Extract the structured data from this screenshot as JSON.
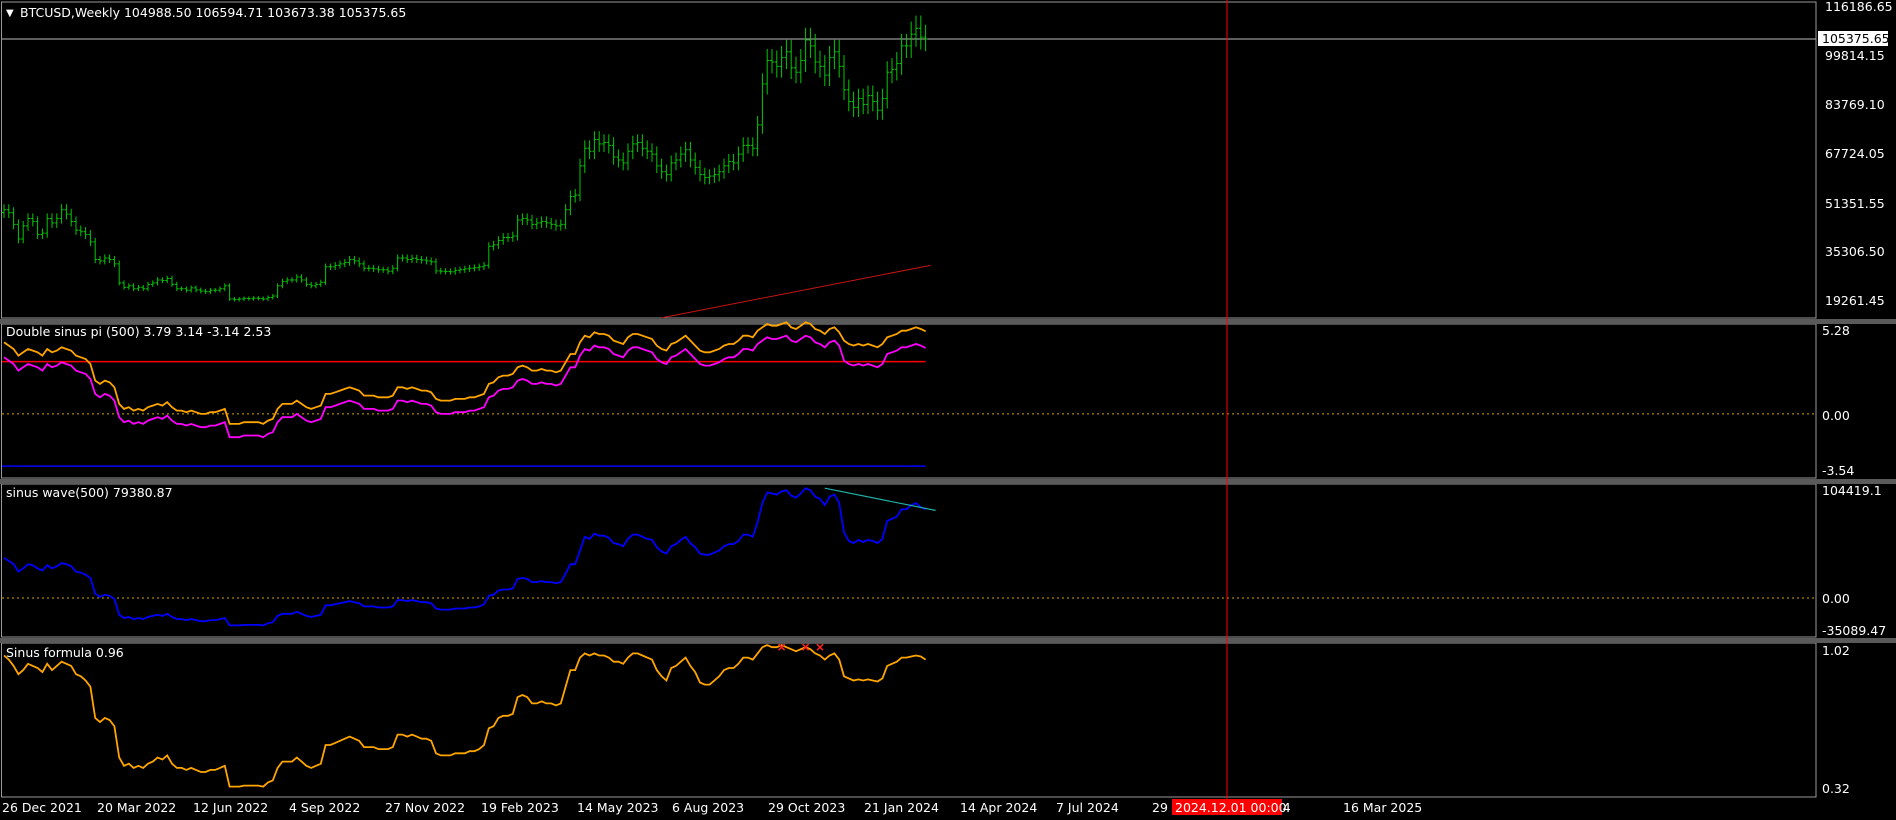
{
  "symbol_header": "BTCUSD,Weekly  104988.50 106594.71 103673.38 105375.65",
  "panes": {
    "price": {
      "price_ticks": [
        "116186.65",
        "99814.15",
        "83769.10",
        "67724.05",
        "51351.55",
        "35306.50",
        "19261.45"
      ],
      "current_price_label": "105375.65",
      "current_price": 105375.65,
      "range": [
        10000,
        118000
      ],
      "bar_color": "#00c800",
      "ma_color": "#c81414"
    },
    "double": {
      "title": "Double sinus pi (500) 3.79 3.14 -3.14 2.53",
      "ticks": [
        "5.28",
        "0.00",
        "-3.54"
      ],
      "range": [
        -3.85,
        5.4
      ],
      "level_red": 3.14,
      "level_blue": -3.14,
      "level_zero": 0,
      "colors": {
        "orange": "#ffa500",
        "magenta": "#ff00ff",
        "red": "#ff0000",
        "blue": "#0000ff",
        "dotted": "#d2aa00"
      }
    },
    "sinus": {
      "title": "sinus wave(500) 79380.87",
      "ticks": [
        "104419.1",
        "0.00",
        "-35089.47"
      ],
      "range": [
        -37000,
        108000
      ],
      "colors": {
        "line": "#0000ff",
        "trend": "#20b2aa",
        "dotted": "#d2aa00"
      }
    },
    "formula": {
      "title": "Sinus formula 0.96",
      "ticks": [
        "1.02",
        "0.32"
      ],
      "range": [
        0.3,
        1.04
      ],
      "colors": {
        "line": "#ffa500",
        "marker": "#ff2020"
      }
    }
  },
  "x_axis": {
    "labels": [
      "26 Dec 2021",
      "20 Mar 2022",
      "12 Jun 2022",
      "4 Sep 2022",
      "27 Nov 2022",
      "19 Feb 2023",
      "14 May 2023",
      "6 Aug 2023",
      "29 Oct 2023",
      "21 Jan 2024",
      "14 Apr 2024",
      "7 Jul 2024",
      "29",
      "c 2024",
      "16 Mar 2025"
    ],
    "cursor_label": "2024.12.01 00:00"
  },
  "chart_data": [
    {
      "type": "candlestick",
      "title": "BTCUSD,Weekly",
      "x_start": "2021-12-26",
      "x_interval": "weekly",
      "ylim": [
        19261.45,
        116186.65
      ],
      "current_price": 105375.65,
      "last_bar_ohlc": [
        104988.5,
        106594.71,
        103673.38,
        105375.65
      ],
      "close": [
        47000,
        46000,
        42000,
        37000,
        41500,
        44000,
        43000,
        38500,
        39000,
        44000,
        42500,
        44000,
        47000,
        45500,
        43000,
        40000,
        39500,
        38500,
        36000,
        30000,
        29500,
        30500,
        30000,
        28500,
        22000,
        20500,
        21000,
        20000,
        20500,
        20000,
        21500,
        22000,
        23000,
        22800,
        23500,
        21500,
        20000,
        20000,
        19500,
        20300,
        19600,
        19200,
        19000,
        19500,
        19500,
        20000,
        21000,
        16500,
        16300,
        16500,
        16700,
        16600,
        16800,
        16700,
        16500,
        17000,
        17500,
        21000,
        22500,
        23000,
        23000,
        24000,
        23000,
        21500,
        21000,
        21500,
        22200,
        27500,
        27500,
        28000,
        28500,
        29000,
        30000,
        29500,
        28500,
        27000,
        27000,
        26800,
        26500,
        26500,
        26000,
        27000,
        30500,
        30500,
        30000,
        30400,
        30000,
        29800,
        29500,
        29200,
        26100,
        26000,
        25900,
        25800,
        26300,
        26500,
        26800,
        27000,
        27200,
        27500,
        28000,
        34500,
        35000,
        36500,
        37500,
        37500,
        38000,
        43500,
        44000,
        43500,
        42000,
        42500,
        43000,
        42500,
        42000,
        41500,
        42000,
        47000,
        51500,
        52000,
        62000,
        68000,
        67000,
        71000,
        69500,
        70000,
        69000,
        65000,
        64000,
        63000,
        67000,
        69500,
        70000,
        68000,
        67000,
        66000,
        62000,
        60000,
        59000,
        63000,
        64000,
        66000,
        67500,
        64000,
        61500,
        59000,
        58000,
        58500,
        59000,
        60000,
        62000,
        63500,
        63000,
        66000,
        69000,
        69000,
        68000,
        76000,
        90000,
        98000,
        97500,
        96000,
        99000,
        101000,
        95500,
        94000,
        98000,
        105000,
        103000,
        97500,
        96000,
        93000,
        99000,
        101000,
        96000,
        88000,
        84000,
        82000,
        85000,
        83000,
        86000,
        84000,
        81000,
        85000,
        94000,
        95000,
        97000,
        103000,
        103000,
        107000,
        109000,
        106000,
        105375
      ]
    },
    {
      "type": "line",
      "title": "Double sinus pi (500) 3.79 3.14 -3.14 2.53",
      "x_start": "2021-12-26",
      "x_interval": "weekly",
      "ylim": [
        -3.54,
        5.28
      ],
      "series": [
        {
          "name": "3.79",
          "values": [
            4.3,
            4.1,
            3.9,
            3.5,
            3.7,
            3.9,
            3.8,
            3.7,
            3.5,
            3.9,
            3.7,
            3.8,
            4.0,
            3.9,
            3.8,
            3.5,
            3.4,
            3.3,
            3.0,
            2.0,
            1.8,
            2.0,
            1.9,
            1.6,
            0.6,
            0.3,
            0.4,
            0.2,
            0.3,
            0.2,
            0.4,
            0.5,
            0.6,
            0.5,
            0.7,
            0.4,
            0.2,
            0.2,
            0.1,
            0.2,
            0.1,
            0.0,
            0.0,
            0.1,
            0.1,
            0.2,
            0.3,
            -0.6,
            -0.6,
            -0.6,
            -0.5,
            -0.5,
            -0.5,
            -0.5,
            -0.6,
            -0.4,
            -0.3,
            0.3,
            0.6,
            0.6,
            0.6,
            0.8,
            0.6,
            0.4,
            0.3,
            0.4,
            0.5,
            1.2,
            1.2,
            1.3,
            1.4,
            1.5,
            1.6,
            1.5,
            1.4,
            1.1,
            1.1,
            1.1,
            1.0,
            1.0,
            1.0,
            1.1,
            1.6,
            1.6,
            1.5,
            1.6,
            1.5,
            1.4,
            1.4,
            1.3,
            0.9,
            0.8,
            0.8,
            0.8,
            0.9,
            0.9,
            0.9,
            1.0,
            1.0,
            1.1,
            1.2,
            1.8,
            1.9,
            2.2,
            2.3,
            2.3,
            2.4,
            2.8,
            2.9,
            2.8,
            2.6,
            2.6,
            2.7,
            2.6,
            2.6,
            2.5,
            2.6,
            3.1,
            3.6,
            3.6,
            4.3,
            4.7,
            4.6,
            4.9,
            4.8,
            4.8,
            4.7,
            4.4,
            4.3,
            4.2,
            4.6,
            4.8,
            4.8,
            4.7,
            4.6,
            4.5,
            4.1,
            3.9,
            3.8,
            4.2,
            4.3,
            4.5,
            4.7,
            4.4,
            4.1,
            3.8,
            3.7,
            3.7,
            3.8,
            3.9,
            4.1,
            4.2,
            4.2,
            4.4,
            4.7,
            4.7,
            4.6,
            5.0,
            5.2,
            5.4,
            5.3,
            5.3,
            5.4,
            5.5,
            5.2,
            5.1,
            5.3,
            5.5,
            5.4,
            5.1,
            5.0,
            4.8,
            5.1,
            5.2,
            4.9,
            4.4,
            4.2,
            4.1,
            4.2,
            4.1,
            4.2,
            4.1,
            4.0,
            4.2,
            4.6,
            4.7,
            4.8,
            5.0,
            5.0,
            5.1,
            5.2,
            5.1,
            4.96
          ]
        },
        {
          "name": "2.53",
          "values": [
            3.4,
            3.2,
            3.0,
            2.6,
            2.8,
            3.0,
            2.9,
            2.8,
            2.6,
            3.0,
            2.8,
            2.9,
            3.1,
            3.0,
            2.9,
            2.6,
            2.5,
            2.4,
            2.1,
            1.2,
            1.0,
            1.2,
            1.1,
            0.8,
            -0.2,
            -0.5,
            -0.4,
            -0.6,
            -0.5,
            -0.6,
            -0.4,
            -0.3,
            -0.2,
            -0.3,
            -0.1,
            -0.4,
            -0.6,
            -0.6,
            -0.7,
            -0.6,
            -0.7,
            -0.8,
            -0.8,
            -0.7,
            -0.7,
            -0.6,
            -0.5,
            -1.4,
            -1.4,
            -1.4,
            -1.3,
            -1.3,
            -1.3,
            -1.3,
            -1.4,
            -1.2,
            -1.1,
            -0.5,
            -0.2,
            -0.2,
            -0.2,
            0.0,
            -0.2,
            -0.4,
            -0.5,
            -0.4,
            -0.3,
            0.4,
            0.4,
            0.5,
            0.6,
            0.7,
            0.8,
            0.7,
            0.6,
            0.3,
            0.3,
            0.3,
            0.2,
            0.2,
            0.2,
            0.3,
            0.8,
            0.8,
            0.7,
            0.8,
            0.7,
            0.6,
            0.6,
            0.5,
            0.1,
            0.0,
            0.0,
            0.0,
            0.1,
            0.1,
            0.1,
            0.2,
            0.2,
            0.3,
            0.4,
            1.0,
            1.1,
            1.4,
            1.5,
            1.5,
            1.6,
            2.0,
            2.1,
            2.0,
            1.8,
            1.8,
            1.9,
            1.8,
            1.8,
            1.7,
            1.8,
            2.3,
            2.8,
            2.8,
            3.5,
            3.9,
            3.8,
            4.1,
            4.0,
            4.0,
            3.9,
            3.6,
            3.5,
            3.4,
            3.8,
            4.0,
            4.0,
            3.9,
            3.8,
            3.7,
            3.3,
            3.1,
            3.0,
            3.4,
            3.5,
            3.7,
            3.9,
            3.6,
            3.3,
            3.0,
            2.9,
            2.9,
            3.0,
            3.1,
            3.3,
            3.4,
            3.4,
            3.6,
            3.9,
            3.9,
            3.8,
            4.2,
            4.4,
            4.6,
            4.5,
            4.5,
            4.6,
            4.7,
            4.4,
            4.3,
            4.5,
            4.7,
            4.6,
            4.3,
            4.2,
            4.0,
            4.3,
            4.4,
            4.1,
            3.2,
            3.0,
            2.9,
            3.0,
            2.9,
            3.0,
            2.9,
            2.8,
            3.0,
            3.6,
            3.7,
            3.8,
            4.0,
            4.0,
            4.1,
            4.2,
            4.1,
            3.96
          ]
        }
      ]
    },
    {
      "type": "line",
      "title": "sinus wave(500) 79380.87",
      "x_start": "2021-12-26",
      "x_interval": "weekly",
      "ylim": [
        -35089.47,
        104419.1
      ],
      "series": [
        {
          "name": "79380.87",
          "values": [
            38000,
            35000,
            32000,
            25000,
            28000,
            32000,
            31000,
            28000,
            26000,
            31000,
            28000,
            30000,
            33000,
            32000,
            30000,
            25000,
            24000,
            22000,
            19000,
            4000,
            1000,
            3000,
            2000,
            -1000,
            -16000,
            -19000,
            -18000,
            -20000,
            -19000,
            -20000,
            -18000,
            -17000,
            -16000,
            -17000,
            -15000,
            -18000,
            -20000,
            -20000,
            -21000,
            -20000,
            -21000,
            -22000,
            -22000,
            -21000,
            -21000,
            -20000,
            -19000,
            -26000,
            -26000,
            -26000,
            -25500,
            -25500,
            -25500,
            -25500,
            -26000,
            -24000,
            -23000,
            -17000,
            -15000,
            -15000,
            -15000,
            -13000,
            -15000,
            -17000,
            -18000,
            -17000,
            -16000,
            -7000,
            -7000,
            -6000,
            -5000,
            -4000,
            -3000,
            -4000,
            -5000,
            -8000,
            -8000,
            -8000,
            -9000,
            -9000,
            -9000,
            -8000,
            -2000,
            -2000,
            -3000,
            -2000,
            -3000,
            -4000,
            -4000,
            -5000,
            -10000,
            -11000,
            -11000,
            -11000,
            -10000,
            -10000,
            -10000,
            -9000,
            -9000,
            -8000,
            -6000,
            2000,
            3000,
            7000,
            8000,
            8000,
            9000,
            18000,
            19000,
            18000,
            15000,
            15000,
            16000,
            15000,
            15000,
            14000,
            15000,
            23000,
            32000,
            32000,
            45000,
            58000,
            56000,
            61000,
            59000,
            59000,
            57000,
            52000,
            51000,
            49000,
            56000,
            60000,
            60000,
            58000,
            56000,
            55000,
            48000,
            44000,
            42000,
            49000,
            51000,
            55000,
            58000,
            52000,
            48000,
            42000,
            41000,
            41000,
            43000,
            45000,
            49000,
            51000,
            51000,
            54000,
            60000,
            60000,
            58000,
            72000,
            90000,
            100000,
            99000,
            98000,
            101000,
            102000,
            97000,
            95000,
            99000,
            104000,
            102000,
            96000,
            94000,
            88000,
            96000,
            98000,
            90000,
            62000,
            54000,
            52000,
            55000,
            53000,
            55000,
            54000,
            52000,
            56000,
            73000,
            75000,
            77000,
            84000,
            84000,
            88000,
            90000,
            86000,
            84000
          ]
        }
      ]
    },
    {
      "type": "line",
      "title": "Sinus formula 0.96",
      "x_start": "2021-12-26",
      "x_interval": "weekly",
      "ylim": [
        0.32,
        1.02
      ],
      "series": [
        {
          "name": "0.96",
          "values": [
            0.98,
            0.96,
            0.93,
            0.89,
            0.91,
            0.94,
            0.93,
            0.92,
            0.9,
            0.94,
            0.91,
            0.93,
            0.95,
            0.94,
            0.93,
            0.89,
            0.88,
            0.86,
            0.83,
            0.68,
            0.66,
            0.68,
            0.67,
            0.64,
            0.49,
            0.45,
            0.46,
            0.44,
            0.45,
            0.44,
            0.46,
            0.47,
            0.49,
            0.48,
            0.5,
            0.46,
            0.44,
            0.44,
            0.43,
            0.44,
            0.43,
            0.42,
            0.42,
            0.43,
            0.43,
            0.44,
            0.45,
            0.35,
            0.35,
            0.35,
            0.355,
            0.355,
            0.355,
            0.355,
            0.35,
            0.37,
            0.38,
            0.44,
            0.47,
            0.47,
            0.47,
            0.49,
            0.47,
            0.45,
            0.44,
            0.45,
            0.46,
            0.55,
            0.55,
            0.56,
            0.57,
            0.58,
            0.59,
            0.58,
            0.57,
            0.54,
            0.54,
            0.54,
            0.53,
            0.53,
            0.53,
            0.54,
            0.6,
            0.6,
            0.59,
            0.6,
            0.59,
            0.58,
            0.58,
            0.57,
            0.51,
            0.5,
            0.5,
            0.5,
            0.51,
            0.51,
            0.51,
            0.52,
            0.52,
            0.53,
            0.55,
            0.63,
            0.64,
            0.68,
            0.69,
            0.69,
            0.7,
            0.78,
            0.79,
            0.78,
            0.75,
            0.75,
            0.76,
            0.75,
            0.75,
            0.74,
            0.75,
            0.83,
            0.91,
            0.91,
            0.97,
            0.99,
            0.98,
            0.99,
            0.98,
            0.98,
            0.97,
            0.95,
            0.95,
            0.94,
            0.97,
            0.99,
            0.99,
            0.98,
            0.97,
            0.96,
            0.91,
            0.88,
            0.86,
            0.92,
            0.93,
            0.95,
            0.97,
            0.93,
            0.9,
            0.85,
            0.84,
            0.84,
            0.86,
            0.88,
            0.91,
            0.92,
            0.92,
            0.94,
            0.97,
            0.97,
            0.96,
            0.99,
            1.02,
            1.03,
            1.02,
            1.02,
            1.03,
            1.02,
            1.01,
            1.0,
            1.01,
            1.02,
            1.01,
            0.99,
            0.98,
            0.96,
            0.98,
            0.99,
            0.96,
            0.88,
            0.87,
            0.86,
            0.865,
            0.86,
            0.865,
            0.86,
            0.855,
            0.87,
            0.93,
            0.94,
            0.95,
            0.97,
            0.97,
            0.975,
            0.98,
            0.975,
            0.96
          ]
        }
      ]
    }
  ]
}
